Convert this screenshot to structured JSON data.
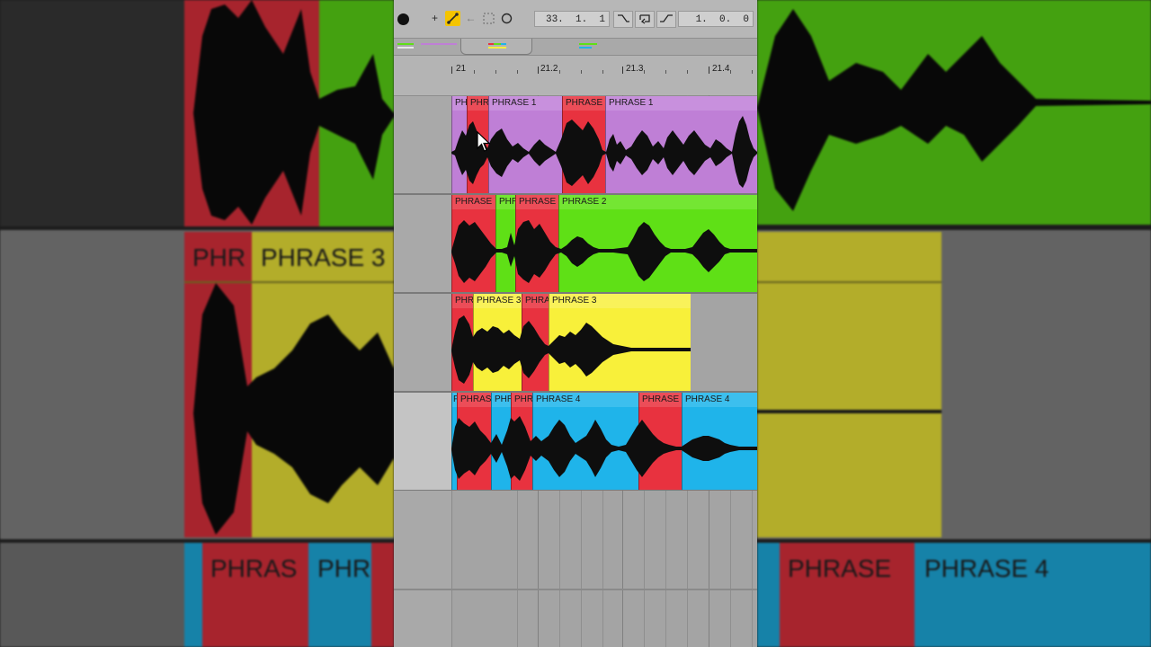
{
  "toolbar": {
    "position": "33.  1.  1",
    "end": "1.  0.  0",
    "icons": [
      "record-dot",
      "plus-icon",
      "draw-mode-icon",
      "back-arrow-icon",
      "loop-select-icon",
      "circle-icon",
      "fade-in-icon",
      "loop-icon",
      "fade-out-icon"
    ]
  },
  "ruler": {
    "labels": [
      "21",
      "21.2",
      "21.3",
      "21.4"
    ]
  },
  "tracks": [
    {
      "color": "#bf7fd6",
      "clips": [
        {
          "label": "PH",
          "color": "#bf7fd6"
        },
        {
          "label": "PHR",
          "color": "#e8323f"
        },
        {
          "label": "PHRASE 1",
          "color": "#bf7fd6"
        },
        {
          "label": "PHRASE",
          "color": "#e8323f"
        },
        {
          "label": "PHRASE 1",
          "color": "#bf7fd6"
        }
      ]
    },
    {
      "color": "#5fe016",
      "clips": [
        {
          "label": "PHRASE",
          "color": "#e8323f"
        },
        {
          "label": "PHR",
          "color": "#5fe016"
        },
        {
          "label": "PHRASE",
          "color": "#e8323f"
        },
        {
          "label": "PHRASE 2",
          "color": "#5fe016"
        }
      ]
    },
    {
      "color": "#f8f03a",
      "clips": [
        {
          "label": "PHR",
          "color": "#e8323f"
        },
        {
          "label": "PHRASE 3",
          "color": "#f8f03a"
        },
        {
          "label": "PHRA",
          "color": "#e8323f"
        },
        {
          "label": "PHRASE 3",
          "color": "#f8f03a"
        }
      ]
    },
    {
      "color": "#1fb4ea",
      "clips": [
        {
          "label": "P",
          "color": "#1fb4ea"
        },
        {
          "label": "PHRAS",
          "color": "#e8323f"
        },
        {
          "label": "PHR",
          "color": "#1fb4ea"
        },
        {
          "label": "PHR",
          "color": "#e8323f"
        },
        {
          "label": "PHRASE 4",
          "color": "#1fb4ea"
        },
        {
          "label": "PHRASE",
          "color": "#e8323f"
        },
        {
          "label": "PHRASE 4",
          "color": "#1fb4ea"
        }
      ]
    }
  ],
  "backdrop": {
    "left_texts": [
      "PHR",
      "PHRASE 3",
      "PHRAS",
      "PHR"
    ],
    "right_texts": [
      "PHRASE",
      "PHRASE 4"
    ]
  },
  "colors": {
    "purple": "#bf7fd6",
    "red": "#e8323f",
    "green": "#5fe016",
    "yellow": "#f8f03a",
    "blue": "#1fb4ea",
    "selected": "#f4c400"
  }
}
